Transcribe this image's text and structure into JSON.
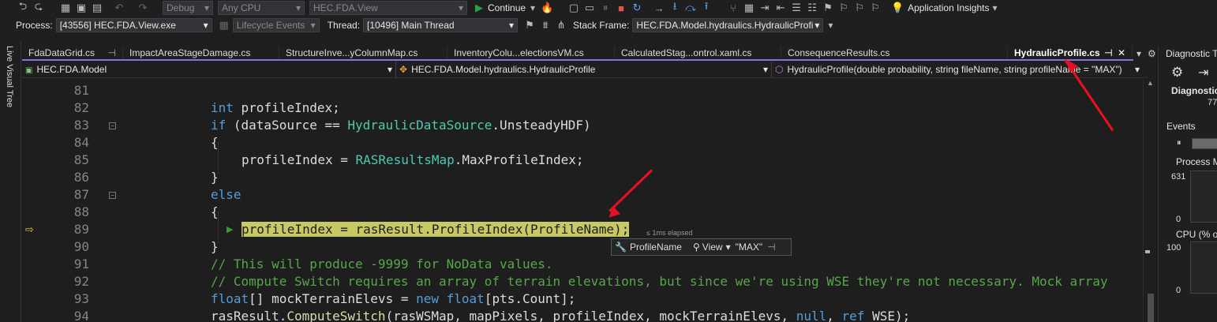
{
  "toolbar": {
    "configuration": "Debug",
    "platform": "Any CPU",
    "startup_project": "HEC.FDA.View",
    "continue_label": "Continue",
    "app_insights_label": "Application Insights"
  },
  "debug_bar": {
    "process_label": "Process:",
    "process_value": "[43556] HEC.FDA.View.exe",
    "lifecycle_label": "Lifecycle Events",
    "thread_label": "Thread:",
    "thread_value": "[10496] Main Thread",
    "stack_label": "Stack Frame:",
    "stack_value": "HEC.FDA.Model.hydraulics.HydraulicProfi"
  },
  "left_panel": {
    "title": "Live Visual Tree"
  },
  "tabs": [
    {
      "label": "FdaDataGrid.cs"
    },
    {
      "label": "ImpactAreaStageDamage.cs"
    },
    {
      "label": "StructureInve...yColumnMap.cs"
    },
    {
      "label": "InventoryColu...electionsVM.cs"
    },
    {
      "label": "CalculatedStag...ontrol.xaml.cs"
    },
    {
      "label": "ConsequenceResults.cs"
    },
    {
      "label": "HydraulicProfile.cs"
    }
  ],
  "navbar": {
    "project": "HEC.FDA.Model",
    "class": "HEC.FDA.Model.hydraulics.HydraulicProfile",
    "member": "HydraulicProfile(double probability, string fileName, string profileName = \"MAX\")"
  },
  "code": {
    "line_numbers": [
      "81",
      "82",
      "83",
      "84",
      "85",
      "86",
      "87",
      "88",
      "89",
      "90",
      "91",
      "92",
      "93",
      "94"
    ],
    "l82_type": "int",
    "l82_rest": " profileIndex;",
    "l83_kw": "if",
    "l83_a": " (dataSource == ",
    "l83_type": "HydraulicDataSource",
    "l83_b": ".UnsteadyHDF)",
    "brace_open": "{",
    "brace_close": "}",
    "l85_a": "profileIndex = ",
    "l85_type": "RASResultsMap",
    "l85_b": ".MaxProfileIndex;",
    "l87_kw": "else",
    "l89_a": "profileIndex = rasResult.",
    "l89_method": "ProfileIndex",
    "l89_b": "(ProfileName);",
    "l91": "// This will produce -9999 for NoData values.",
    "l92": "// Compute Switch requires an array of terrain elevations, but since we're using WSE they're not necessary. Mock array",
    "l93_type": "float",
    "l93_a": "[] mockTerrainElevs = ",
    "l93_kw": "new",
    "l93_type2": "float",
    "l93_b": "[pts.Count];",
    "l94_a": "rasResult.",
    "l94_method": "ComputeSwitch",
    "l94_b": "(rasWSMap, mapPixels, profileIndex, mockTerrainElevs, ",
    "l94_kw": "null",
    "l94_c": ", ",
    "l94_kw2": "ref",
    "l94_d": " WSE);"
  },
  "elapsed": "≤ 1ms elapsed",
  "datatip": {
    "name": "ProfileName",
    "view": "View",
    "value": "\"MAX\""
  },
  "diagnostics": {
    "title": "Diagnostic T",
    "subtitle": "Diagnostics",
    "partial_number": "77",
    "events_label": "Events",
    "process_memory_label": "Process M",
    "mem_max": "631",
    "mem_min": "0",
    "cpu_label": "CPU (% of",
    "cpu_max": "100",
    "cpu_min": "0"
  },
  "colors": {
    "accent": "#8a6fdf",
    "highlight": "#c8c864",
    "arrow": "#e81123"
  }
}
